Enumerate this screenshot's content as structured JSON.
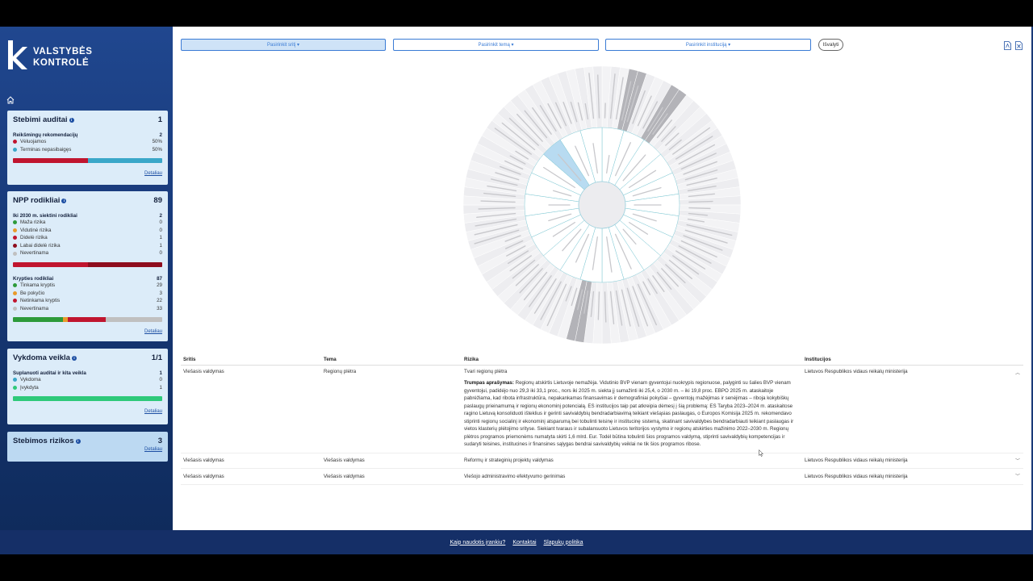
{
  "brand": {
    "line1": "VALSTYBĖS",
    "line2": "KONTROLĖ"
  },
  "colors": {
    "red": "#c0152f",
    "teal": "#3aa7c9",
    "green": "#2d9a3a",
    "orange": "#e89a2c",
    "grey": "#c0c0c0",
    "darkred": "#8e0d1e",
    "lightgreen": "#2ec97a"
  },
  "cards": {
    "audits": {
      "title": "Stebimi auditai",
      "count": "1",
      "section": "Reikšmingų rekomendacijų",
      "section_count": "2",
      "rows": [
        {
          "label": "Vėluojamos",
          "value": "50%"
        },
        {
          "label": "Terminas nepasibaigęs",
          "value": "50%"
        }
      ],
      "bar": [
        0.5,
        0.5
      ],
      "detail": "Detaliau"
    },
    "npp": {
      "title": "NPP rodikliai",
      "count": "89",
      "section1": "Iki 2030 m. siektini rodikliai",
      "section1_count": "2",
      "rows1": [
        {
          "label": "Maža rizika",
          "value": "0"
        },
        {
          "label": "Vidutinė rizika",
          "value": "0"
        },
        {
          "label": "Didelė rizika",
          "value": "1"
        },
        {
          "label": "Labai didelė rizika",
          "value": "1"
        },
        {
          "label": "Nevertinama",
          "value": "0"
        }
      ],
      "bar1": [
        0.5,
        0.5
      ],
      "section2": "Krypties rodikliai",
      "section2_count": "87",
      "rows2": [
        {
          "label": "Tinkama kryptis",
          "value": "29"
        },
        {
          "label": "Be pokyčio",
          "value": "3"
        },
        {
          "label": "Netinkama kryptis",
          "value": "22"
        },
        {
          "label": "Nevertinama",
          "value": "33"
        }
      ],
      "bar2": [
        29,
        3,
        22,
        33
      ],
      "detail": "Detaliau"
    },
    "activity": {
      "title": "Vykdoma veikla",
      "count": "1/1",
      "section": "Suplanuoti auditai ir kita veikla",
      "section_count": "1",
      "rows": [
        {
          "label": "Vykdoma",
          "value": "0"
        },
        {
          "label": "Įvykdyta",
          "value": "1"
        }
      ],
      "bar": [
        1
      ],
      "detail": "Detaliau"
    },
    "risks": {
      "title": "Stebimos rizikos",
      "count": "3",
      "detail": "Detaliau"
    }
  },
  "filters": {
    "area": "Pasirinkit sritį ▾",
    "topic": "Pasirinkit temą ▾",
    "institution": "Pasirinkit instituciją ▾",
    "clear": "Išvalyti"
  },
  "table": {
    "headers": [
      "Sritis",
      "Tema",
      "Rizika",
      "Institucijos"
    ],
    "rows": [
      {
        "area": "Viešasis valdymas",
        "topic": "Regionų plėtra",
        "risk": "Tvari regionų plėtra",
        "institution": "Lietuvos Respublikos vidaus reikalų ministerija",
        "summary_label": "Trumpas aprašymas:",
        "summary": "Regionų atskirtis Lietuvoje nemažėja. Vidutinio BVP vienam gyventojui nuokrypis regionuose, palyginti su šalies BVP vienam gyventojui, padidėjo nuo 29,3 iki 33,1 proc., nors iki 2025 m. siekta jį sumažinti iki 25,4, o 2030 m. – iki 19,8 proc. EBPO 2025 m. ataskaitoje pabrėžiama, kad ribota infrastruktūra, nepakankamas finansavimas ir demografiniai pokyčiai – gyventojų mažėjimas ir senėjimas – riboja kokybiškų paslaugų prieinamumą ir regionų ekonominį potencialą. ES institucijos taip pat atkreipia dėmesį į šią problemą: ES Taryba 2023–2024 m. ataskaitose ragino Lietuvą konsoliduoti išteklius ir gerinti savivaldybių bendradarbiavimą teikiant viešąsias paslaugas, o Europos Komisija 2025 m. rekomendavo stiprinti regionų socialinį ir ekonominį atsparumą bei tobulinti teisinę ir institucinę sistemą, skatinant savivaldybes bendradarbiauti teikiant paslaugas ir vietos klasterių plėtojimo srityse. Siekiant tvaraus ir subalansuoto Lietuvos teritorijos vystymo ir regionų atskirties mažinimo 2022–2030 m. Regionų plėtros programos priemonėms numatyta skirti 1,6 mlrd. Eur. Todėl būtina tobulinti šios programos valdymą, stiprinti savivaldybių kompetencijas ir sudaryti teisines, institucines ir finansines sąlygas bendrai savivaldybių veiklai ne tik šios programos ribose."
      },
      {
        "area": "Viešasis valdymas",
        "topic": "Viešasis valdymas",
        "risk": "Reformų ir strateginių projektų valdymas",
        "institution": "Lietuvos Respublikos vidaus reikalų ministerija"
      },
      {
        "area": "Viešasis valdymas",
        "topic": "Viešasis valdymas",
        "risk": "Viešojo administravimo efektyvumo gerinimas",
        "institution": "Lietuvos Respublikos vidaus reikalų ministerija"
      }
    ]
  },
  "footer": {
    "links": [
      "Kaip naudotis įrankiu?",
      "Kontaktai",
      "Slapukų politika"
    ]
  }
}
